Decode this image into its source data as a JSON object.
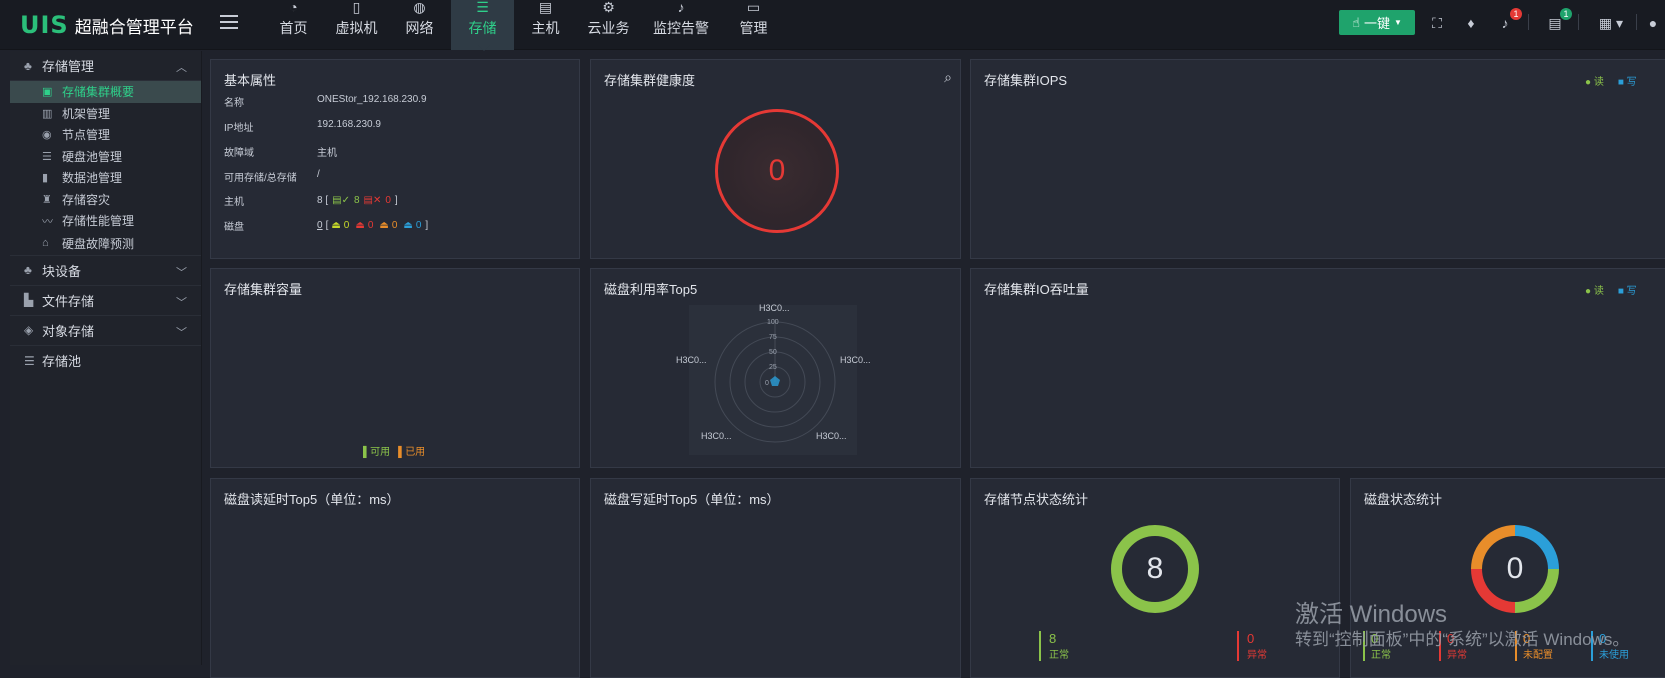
{
  "header": {
    "logo_mark": "UIS",
    "logo_title": "超融合管理平台",
    "nav": [
      {
        "label": "首页",
        "icon": "dashboard-icon"
      },
      {
        "label": "虚拟机",
        "icon": "vm-icon"
      },
      {
        "label": "网络",
        "icon": "globe-icon"
      },
      {
        "label": "存储",
        "icon": "database-icon",
        "active": true
      },
      {
        "label": "主机",
        "icon": "server-icon"
      },
      {
        "label": "云业务",
        "icon": "gear-icon"
      },
      {
        "label": "监控告警",
        "icon": "bell-icon"
      },
      {
        "label": "管理",
        "icon": "monitor-icon"
      }
    ],
    "onekey_label": "一键",
    "alert_badge": "1",
    "task_badge": "1"
  },
  "sidebar": {
    "group_storage": "存储管理",
    "items": [
      {
        "label": "存储集群概要",
        "active": true
      },
      {
        "label": "机架管理"
      },
      {
        "label": "节点管理"
      },
      {
        "label": "硬盘池管理"
      },
      {
        "label": "数据池管理"
      },
      {
        "label": "存储容灾"
      },
      {
        "label": "存储性能管理"
      },
      {
        "label": "硬盘故障预测"
      }
    ],
    "group_block": "块设备",
    "group_file": "文件存储",
    "group_object": "对象存储",
    "group_pool": "存储池"
  },
  "basic": {
    "title": "基本属性",
    "rows": [
      {
        "k": "名称",
        "v": "ONEStor_192.168.230.9"
      },
      {
        "k": "IP地址",
        "v": "192.168.230.9"
      },
      {
        "k": "故障域",
        "v": "主机"
      },
      {
        "k": "可用存储/总存储",
        "v": "/"
      }
    ],
    "host_label": "主机",
    "host_total": "8 [",
    "host_ok": "8",
    "host_err": "0",
    "host_end": "]",
    "disk_label": "磁盘",
    "disk_total": "0",
    "disk_open": "[",
    "disk_vals": [
      "0",
      "0",
      "0",
      "0"
    ],
    "disk_end": "]"
  },
  "health": {
    "title": "存储集群健康度",
    "value": "0"
  },
  "iops": {
    "title": "存储集群IOPS",
    "read": "读",
    "write": "写"
  },
  "capacity": {
    "title": "存储集群容量",
    "avail": "可用",
    "used": "已用"
  },
  "disk_usage": {
    "title": "磁盘利用率Top5",
    "ticks": [
      "100",
      "75",
      "50",
      "25",
      "0"
    ],
    "labels": [
      "H3C0...",
      "H3C0...",
      "H3C0...",
      "H3C0...",
      "H3C0..."
    ]
  },
  "throughput": {
    "title": "存储集群IO吞吐量",
    "read": "读",
    "write": "写"
  },
  "read_latency": {
    "title": "磁盘读延时Top5（单位：ms）"
  },
  "write_latency": {
    "title": "磁盘写延时Top5（单位：ms）"
  },
  "node_stats": {
    "title": "存储节点状态统计",
    "value": "8",
    "normal_val": "8",
    "normal": "正常",
    "abnormal_val": "0",
    "abnormal": "异常"
  },
  "disk_stats": {
    "title": "磁盘状态统计",
    "value": "0",
    "s1_val": "0",
    "s1": "正常",
    "s2_val": "0",
    "s2": "异常",
    "s3_val": "0",
    "s3": "未配置",
    "s4_val": "0",
    "s4": "未使用"
  },
  "watermark": {
    "line1": "激活 Windows",
    "line2": "转到“控制面板”中的“系统”以激活 Windows。"
  },
  "colors": {
    "accent": "#2fd08a",
    "danger": "#e53935",
    "ok": "#8bc34a",
    "warn": "#e88d2a",
    "info": "#2b9fd9"
  }
}
